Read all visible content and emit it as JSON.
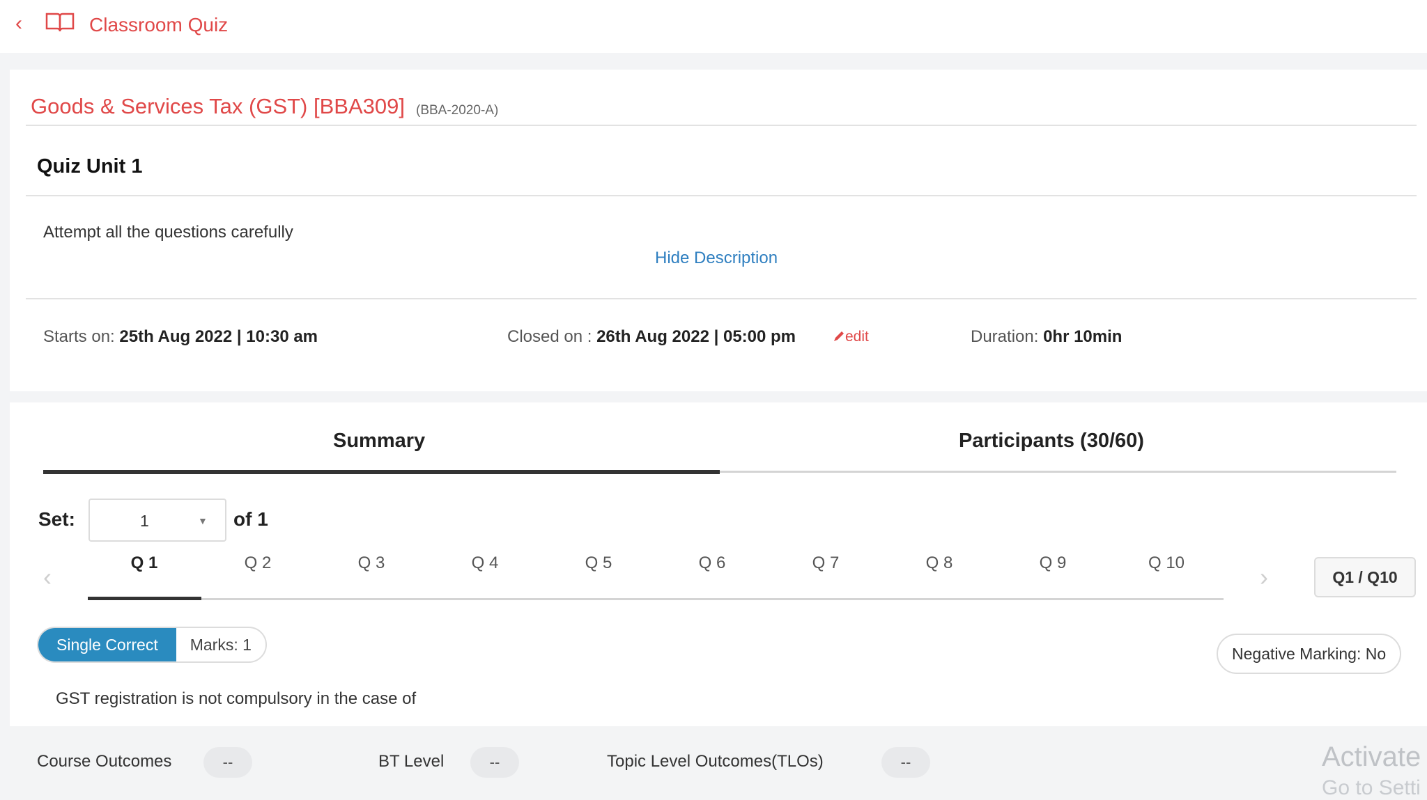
{
  "header": {
    "title": "Classroom Quiz",
    "back_icon": "chevron-left-icon",
    "book_icon": "book-icon"
  },
  "course": {
    "title": "Goods & Services Tax (GST) [BBA309]",
    "code": "(BBA-2020-A)"
  },
  "quiz": {
    "title": "Quiz Unit 1",
    "description": "Attempt all the questions carefully",
    "hide_description": "Hide Description",
    "starts_label": "Starts on:",
    "starts_value": "25th Aug 2022 | 10:30 am",
    "closed_label": "Closed on :",
    "closed_value": "26th Aug 2022 | 05:00 pm",
    "edit_label": "edit",
    "duration_label": "Duration:",
    "duration_value": "0hr 10min"
  },
  "tabs": {
    "summary": "Summary",
    "participants": "Participants (30/60)"
  },
  "set": {
    "label": "Set:",
    "value": "1",
    "of": "of 1"
  },
  "questions": {
    "tabs": [
      "Q 1",
      "Q 2",
      "Q 3",
      "Q 4",
      "Q 5",
      "Q 6",
      "Q 7",
      "Q 8",
      "Q 9",
      "Q 10"
    ],
    "active_index": 0,
    "counter": "Q1 / Q10"
  },
  "question_detail": {
    "type": "Single Correct",
    "marks": "Marks: 1",
    "negative_marking": "Negative Marking: No",
    "text": "GST registration is not compulsory in the case of"
  },
  "outcomes": {
    "course_outcomes_label": "Course Outcomes",
    "course_outcomes_value": "--",
    "bt_level_label": "BT Level",
    "bt_level_value": "--",
    "tlo_label": "Topic Level Outcomes(TLOs)",
    "tlo_value": "--"
  },
  "watermark": {
    "line1": "Activate",
    "line2": "Go to Setti"
  },
  "colors": {
    "accent_red": "#e04848",
    "link_blue": "#2f7fc0",
    "badge_blue": "#2a8bbf"
  }
}
